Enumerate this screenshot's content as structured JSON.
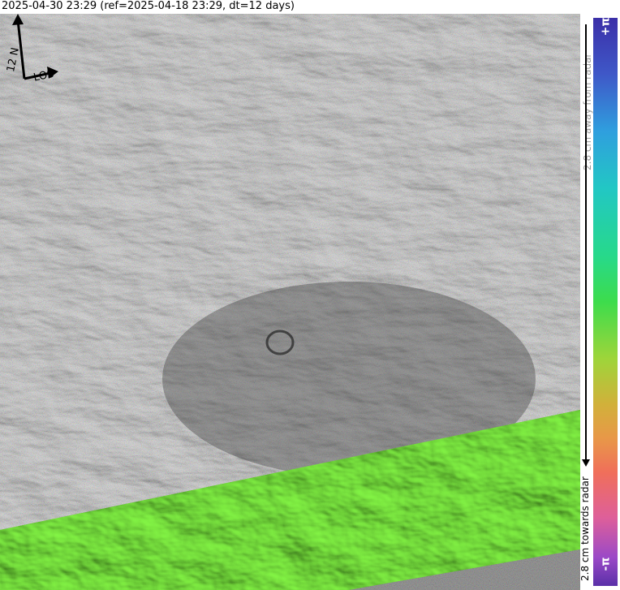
{
  "header": {
    "title": "2025-04-30 23:29 (ref=2025-04-18 23:29, dt=12 days)"
  },
  "compass": {
    "north_label": "12 N",
    "los_label": "LOS"
  },
  "colorbar": {
    "top_label": "+π",
    "bottom_label": "-π",
    "away_label": "2.8 cm away from radar",
    "towards_label": "2.8 cm towards radar"
  },
  "colors": {
    "green_terrain": "#6fe63c",
    "gray_terrain": "#6d6d6d",
    "phase_top": "#3b2fa8",
    "phase_bottom": "#5a30a8"
  }
}
